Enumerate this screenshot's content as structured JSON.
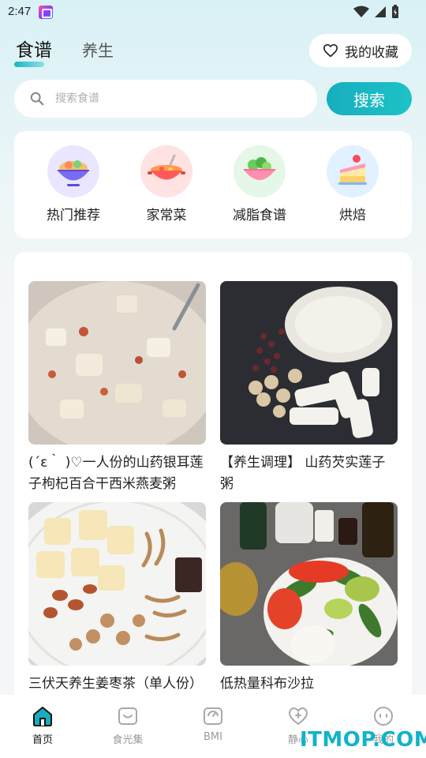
{
  "status_bar": {
    "time": "2:47"
  },
  "header": {
    "tabs": [
      {
        "label": "食谱",
        "active": true
      },
      {
        "label": "养生",
        "active": false
      }
    ],
    "favorites_label": "我的收藏"
  },
  "search": {
    "placeholder": "搜索食谱",
    "button_label": "搜索"
  },
  "categories": [
    {
      "label": "热门推荐",
      "icon": "salad-bowl-icon"
    },
    {
      "label": "家常菜",
      "icon": "soup-pot-icon"
    },
    {
      "label": "减脂食谱",
      "icon": "vegetable-bowl-icon"
    },
    {
      "label": "烘焙",
      "icon": "cake-icon"
    }
  ],
  "recipes": [
    {
      "title": "(´ε｀ )♡一人份的山药银耳莲子枸杞百合干西米燕麦粥"
    },
    {
      "title": "【养生调理】 山药芡实莲子粥"
    },
    {
      "title": "三伏天养生姜枣茶（单人份）"
    },
    {
      "title": "低热量科布沙拉"
    }
  ],
  "bottom_nav": [
    {
      "label": "首页",
      "active": true
    },
    {
      "label": "食光集",
      "active": false
    },
    {
      "label": "BMI",
      "active": false
    },
    {
      "label": "静心",
      "active": false
    },
    {
      "label": "我的",
      "active": false
    }
  ],
  "watermark": "ITMOP.COM",
  "colors": {
    "accent": "#16aebf",
    "background_top": "#d9f1f5"
  }
}
